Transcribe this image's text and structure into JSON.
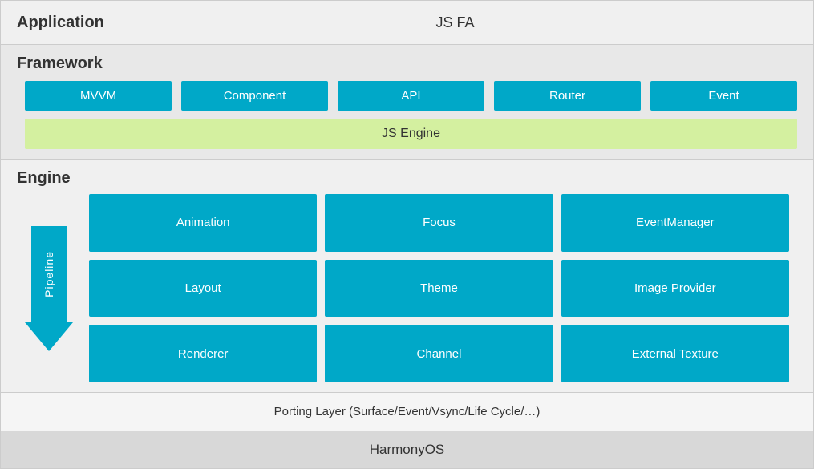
{
  "application": {
    "label": "Application",
    "content": "JS FA"
  },
  "framework": {
    "label": "Framework",
    "boxes": [
      {
        "id": "mvvm",
        "text": "MVVM"
      },
      {
        "id": "component",
        "text": "Component"
      },
      {
        "id": "api",
        "text": "API"
      },
      {
        "id": "router",
        "text": "Router"
      },
      {
        "id": "event",
        "text": "Event"
      }
    ],
    "jsEngine": "JS Engine"
  },
  "engine": {
    "label": "Engine",
    "pipeline": "Pipeline",
    "grid": [
      {
        "id": "animation",
        "text": "Animation"
      },
      {
        "id": "focus",
        "text": "Focus"
      },
      {
        "id": "event-manager",
        "text": "EventManager"
      },
      {
        "id": "layout",
        "text": "Layout"
      },
      {
        "id": "theme",
        "text": "Theme"
      },
      {
        "id": "image-provider",
        "text": "Image Provider"
      },
      {
        "id": "renderer",
        "text": "Renderer"
      },
      {
        "id": "channel",
        "text": "Channel"
      },
      {
        "id": "external-texture",
        "text": "External Texture"
      }
    ]
  },
  "porting": {
    "text": "Porting Layer (Surface/Event/Vsync/Life Cycle/…)"
  },
  "harmony": {
    "text": "HarmonyOS"
  }
}
